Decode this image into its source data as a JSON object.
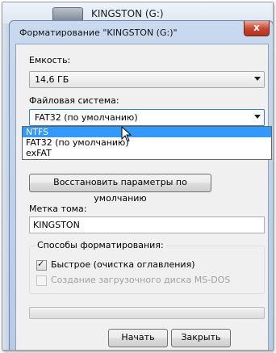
{
  "background_window": {
    "title": "KINGSTON (G:)"
  },
  "dialog": {
    "title": "Форматирование \"KINGSTON (G:)\"",
    "close_glyph": "x",
    "capacity_label": "Емкость:",
    "capacity_value": "14,6 ГБ",
    "filesystem_label": "Файловая система:",
    "filesystem_value": "FAT32 (по умолчанию)",
    "filesystem_options": [
      "NTFS",
      "FAT32 (по умолчанию)",
      "exFAT"
    ],
    "filesystem_highlighted": "NTFS",
    "restore_defaults_label": "Восстановить параметры по умолчанию",
    "volume_label_caption": "Метка тома:",
    "volume_label_value": "KINGSTON",
    "format_options_caption": "Способы форматирования:",
    "quick_format_label": "Быстрое (очистка оглавления)",
    "quick_format_checked": true,
    "msdos_label": "Создание загрузочного диска MS-DOS",
    "msdos_enabled": false,
    "progress": 0,
    "start_label": "Начать",
    "close_label": "Закрыть"
  }
}
